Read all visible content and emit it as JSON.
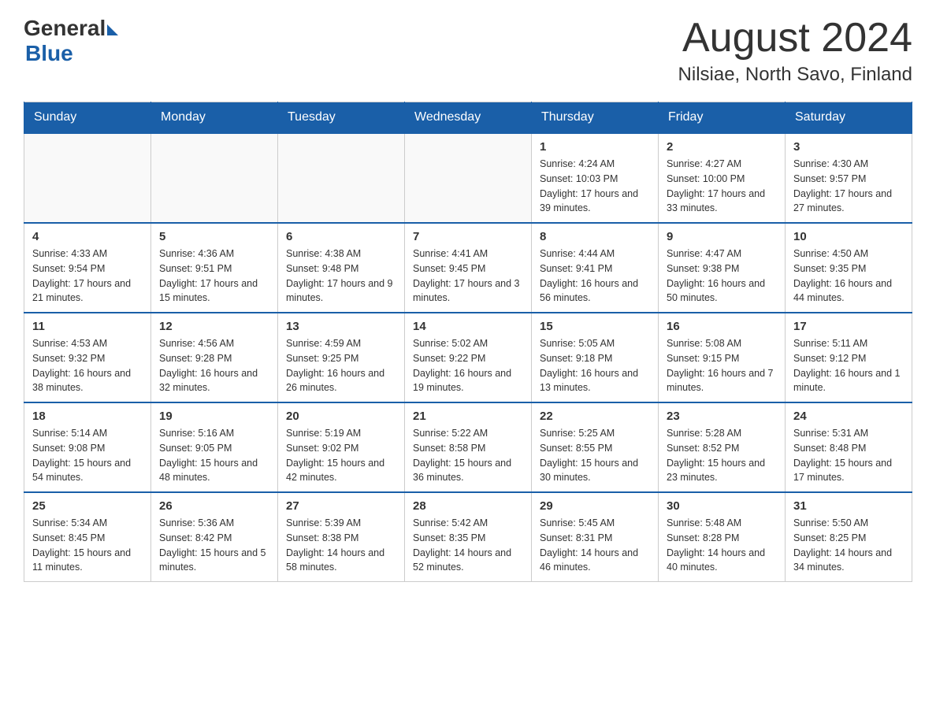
{
  "logo": {
    "line1": "General",
    "triangle": true,
    "line2": "Blue"
  },
  "title": "August 2024",
  "subtitle": "Nilsiae, North Savo, Finland",
  "days_of_week": [
    "Sunday",
    "Monday",
    "Tuesday",
    "Wednesday",
    "Thursday",
    "Friday",
    "Saturday"
  ],
  "weeks": [
    [
      {
        "day": "",
        "info": ""
      },
      {
        "day": "",
        "info": ""
      },
      {
        "day": "",
        "info": ""
      },
      {
        "day": "",
        "info": ""
      },
      {
        "day": "1",
        "info": "Sunrise: 4:24 AM\nSunset: 10:03 PM\nDaylight: 17 hours\nand 39 minutes."
      },
      {
        "day": "2",
        "info": "Sunrise: 4:27 AM\nSunset: 10:00 PM\nDaylight: 17 hours\nand 33 minutes."
      },
      {
        "day": "3",
        "info": "Sunrise: 4:30 AM\nSunset: 9:57 PM\nDaylight: 17 hours\nand 27 minutes."
      }
    ],
    [
      {
        "day": "4",
        "info": "Sunrise: 4:33 AM\nSunset: 9:54 PM\nDaylight: 17 hours\nand 21 minutes."
      },
      {
        "day": "5",
        "info": "Sunrise: 4:36 AM\nSunset: 9:51 PM\nDaylight: 17 hours\nand 15 minutes."
      },
      {
        "day": "6",
        "info": "Sunrise: 4:38 AM\nSunset: 9:48 PM\nDaylight: 17 hours\nand 9 minutes."
      },
      {
        "day": "7",
        "info": "Sunrise: 4:41 AM\nSunset: 9:45 PM\nDaylight: 17 hours\nand 3 minutes."
      },
      {
        "day": "8",
        "info": "Sunrise: 4:44 AM\nSunset: 9:41 PM\nDaylight: 16 hours\nand 56 minutes."
      },
      {
        "day": "9",
        "info": "Sunrise: 4:47 AM\nSunset: 9:38 PM\nDaylight: 16 hours\nand 50 minutes."
      },
      {
        "day": "10",
        "info": "Sunrise: 4:50 AM\nSunset: 9:35 PM\nDaylight: 16 hours\nand 44 minutes."
      }
    ],
    [
      {
        "day": "11",
        "info": "Sunrise: 4:53 AM\nSunset: 9:32 PM\nDaylight: 16 hours\nand 38 minutes."
      },
      {
        "day": "12",
        "info": "Sunrise: 4:56 AM\nSunset: 9:28 PM\nDaylight: 16 hours\nand 32 minutes."
      },
      {
        "day": "13",
        "info": "Sunrise: 4:59 AM\nSunset: 9:25 PM\nDaylight: 16 hours\nand 26 minutes."
      },
      {
        "day": "14",
        "info": "Sunrise: 5:02 AM\nSunset: 9:22 PM\nDaylight: 16 hours\nand 19 minutes."
      },
      {
        "day": "15",
        "info": "Sunrise: 5:05 AM\nSunset: 9:18 PM\nDaylight: 16 hours\nand 13 minutes."
      },
      {
        "day": "16",
        "info": "Sunrise: 5:08 AM\nSunset: 9:15 PM\nDaylight: 16 hours\nand 7 minutes."
      },
      {
        "day": "17",
        "info": "Sunrise: 5:11 AM\nSunset: 9:12 PM\nDaylight: 16 hours\nand 1 minute."
      }
    ],
    [
      {
        "day": "18",
        "info": "Sunrise: 5:14 AM\nSunset: 9:08 PM\nDaylight: 15 hours\nand 54 minutes."
      },
      {
        "day": "19",
        "info": "Sunrise: 5:16 AM\nSunset: 9:05 PM\nDaylight: 15 hours\nand 48 minutes."
      },
      {
        "day": "20",
        "info": "Sunrise: 5:19 AM\nSunset: 9:02 PM\nDaylight: 15 hours\nand 42 minutes."
      },
      {
        "day": "21",
        "info": "Sunrise: 5:22 AM\nSunset: 8:58 PM\nDaylight: 15 hours\nand 36 minutes."
      },
      {
        "day": "22",
        "info": "Sunrise: 5:25 AM\nSunset: 8:55 PM\nDaylight: 15 hours\nand 30 minutes."
      },
      {
        "day": "23",
        "info": "Sunrise: 5:28 AM\nSunset: 8:52 PM\nDaylight: 15 hours\nand 23 minutes."
      },
      {
        "day": "24",
        "info": "Sunrise: 5:31 AM\nSunset: 8:48 PM\nDaylight: 15 hours\nand 17 minutes."
      }
    ],
    [
      {
        "day": "25",
        "info": "Sunrise: 5:34 AM\nSunset: 8:45 PM\nDaylight: 15 hours\nand 11 minutes."
      },
      {
        "day": "26",
        "info": "Sunrise: 5:36 AM\nSunset: 8:42 PM\nDaylight: 15 hours\nand 5 minutes."
      },
      {
        "day": "27",
        "info": "Sunrise: 5:39 AM\nSunset: 8:38 PM\nDaylight: 14 hours\nand 58 minutes."
      },
      {
        "day": "28",
        "info": "Sunrise: 5:42 AM\nSunset: 8:35 PM\nDaylight: 14 hours\nand 52 minutes."
      },
      {
        "day": "29",
        "info": "Sunrise: 5:45 AM\nSunset: 8:31 PM\nDaylight: 14 hours\nand 46 minutes."
      },
      {
        "day": "30",
        "info": "Sunrise: 5:48 AM\nSunset: 8:28 PM\nDaylight: 14 hours\nand 40 minutes."
      },
      {
        "day": "31",
        "info": "Sunrise: 5:50 AM\nSunset: 8:25 PM\nDaylight: 14 hours\nand 34 minutes."
      }
    ]
  ]
}
